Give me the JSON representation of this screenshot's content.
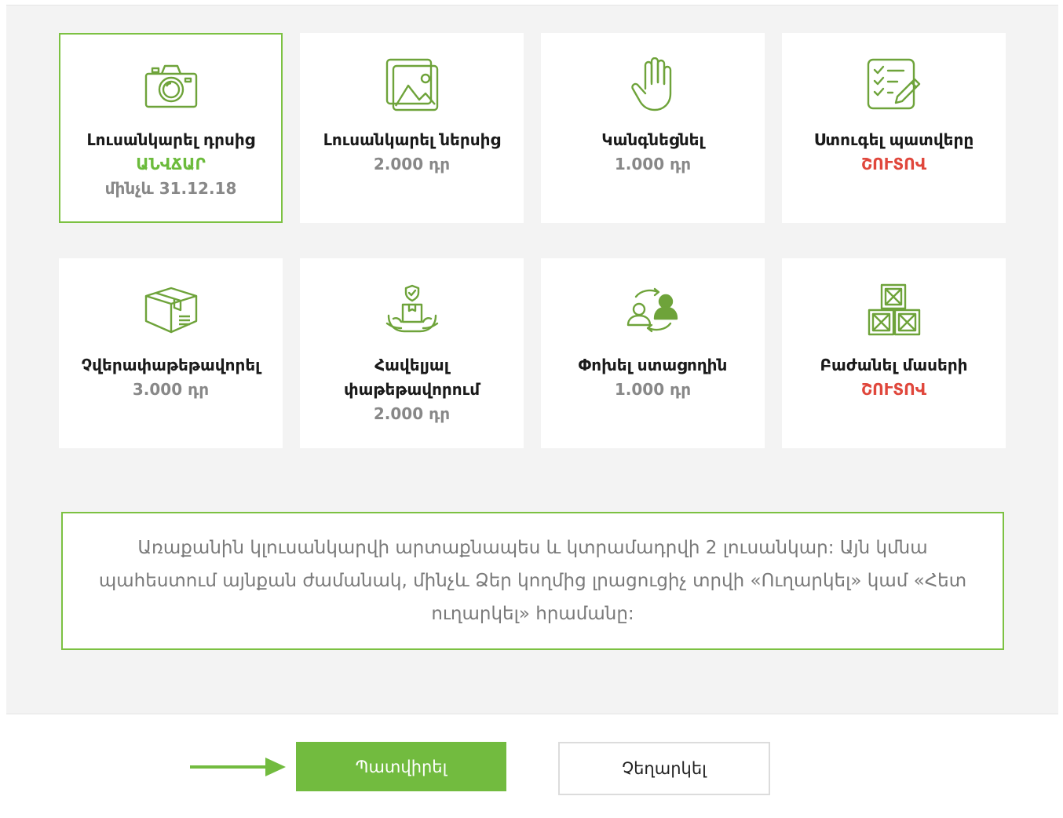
{
  "services": [
    {
      "icon": "camera-icon",
      "title": "Լուսանկարել դրսից",
      "line2": "ԱՆՎՃԱՐ",
      "line3": "մինչև 31.12.18"
    },
    {
      "icon": "image-icon",
      "title": "Լուսանկարել ներսից",
      "line2": "2.000 դր"
    },
    {
      "icon": "hand-stop-icon",
      "title": "Կանգնեցնել",
      "line2": "1.000 դր"
    },
    {
      "icon": "checklist-icon",
      "title": "Ստուգել պատվերը",
      "line2": "ՇՈՒՏՈՎ"
    },
    {
      "icon": "box-icon",
      "title": "Չվերափաթեթավորել",
      "line2": "3.000 դր"
    },
    {
      "icon": "package-protect-icon",
      "title": "Հավելյալ փաթեթավորում",
      "line2": "2.000 դր"
    },
    {
      "icon": "change-recipient-icon",
      "title": "Փոխել ստացողին",
      "line2": "1.000 դր"
    },
    {
      "icon": "crates-icon",
      "title": "Բաժանել մասերի",
      "line2": "ՇՈՒՏՈՎ"
    }
  ],
  "note": "Առաքանին կլուսանկարվի արտաքնապես և կտրամադրվի 2 լուսանկար: Այն կմնա պահեստում այնքան ժամանակ, մինչև Ձեր կողմից լրացուցիչ տրվի «Ուղարկել» կամ «Հետ ուղարկել» հրամանը:",
  "buttons": {
    "confirm": "Պատվիրել",
    "cancel": "Չեղարկել"
  },
  "colors": {
    "accent": "#72bb3f",
    "soon": "#e0473c",
    "price": "#888888"
  }
}
